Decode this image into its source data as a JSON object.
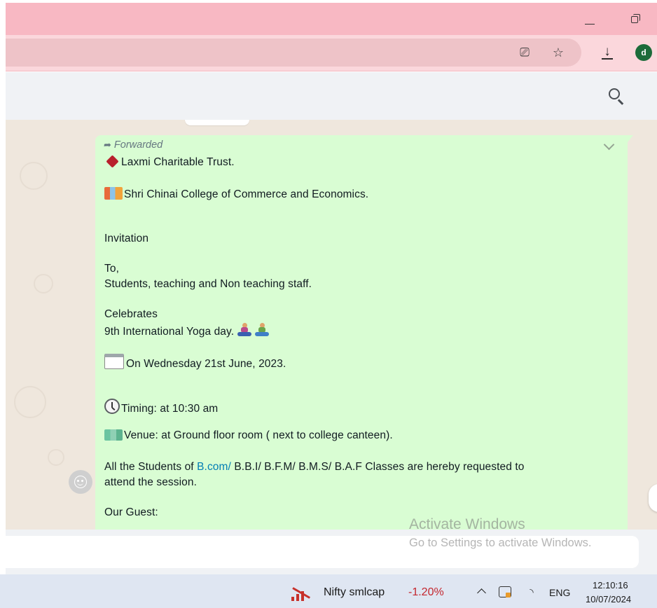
{
  "browser": {
    "account_initial": "d"
  },
  "message": {
    "forwarded_label": "Forwarded",
    "lines": {
      "org": "Laxmi Charitable Trust.",
      "college": "Shri Chinai College of Commerce and Economics.",
      "invitation": "Invitation",
      "to": "To,",
      "audience": "Students, teaching and Non teaching staff.",
      "celebrates": "Celebrates",
      "event": "9th International Yoga day.",
      "date": "On Wednesday 21st June, 2023.",
      "timing": "Timing: at 10:30 am",
      "venue": "Venue: at Ground floor room ( next to college canteen).",
      "students_prefix": "All the Students of ",
      "students_link": "B.com/",
      "students_suffix": " B.B.I/ B.F.M/ B.M.S/ B.A.F Classes are hereby requested to",
      "students_line2": "attend the session.",
      "guest": "Our Guest:"
    },
    "colors": {
      "bubble": "#d9fdd3",
      "link": "#027eb5"
    }
  },
  "watermark": {
    "title": "Activate Windows",
    "subtitle": "Go to Settings to activate Windows."
  },
  "taskbar": {
    "stock_name": "Nifty smlcap",
    "stock_change": "-1.20%",
    "language": "ENG",
    "time": "12:10:16",
    "date": "10/07/2024"
  },
  "icons": [
    "minimize-icon",
    "restore-icon",
    "cast-icon",
    "star-icon",
    "download-icon",
    "search-icon",
    "forward-arrow-icon",
    "chevron-down-icon",
    "diamond-icon",
    "school-icon",
    "yoga-icon",
    "calendar-icon",
    "clock-icon",
    "map-icon",
    "emoji-icon",
    "stock-chart-icon",
    "tray-chevron-icon",
    "meet-icon",
    "wifi-icon"
  ]
}
